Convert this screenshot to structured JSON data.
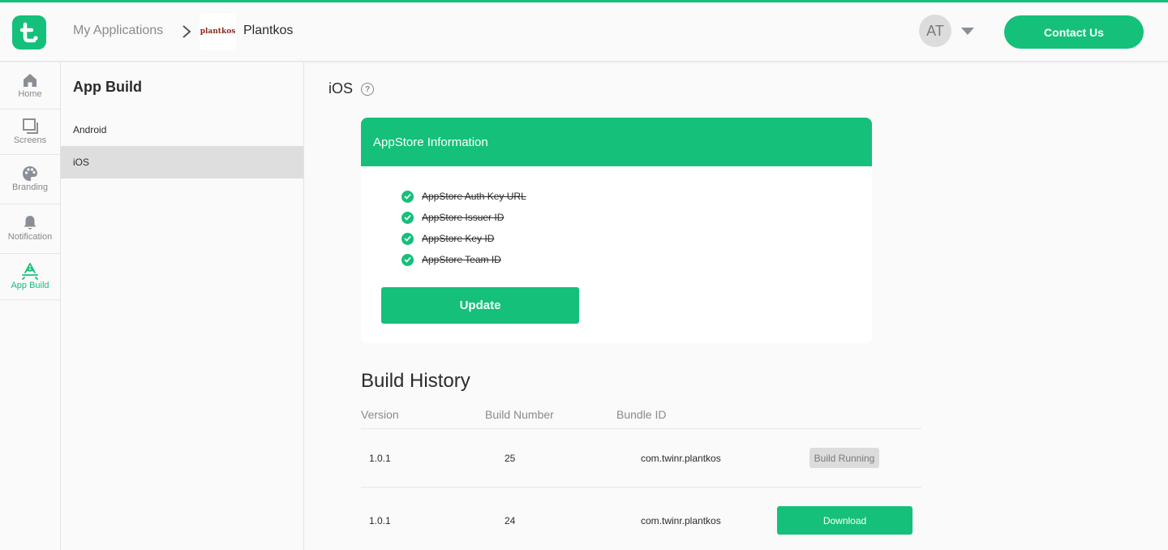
{
  "header": {
    "breadcrumb_apps": "My Applications",
    "app_logo_text": "plantkos",
    "app_name": "Plantkos",
    "avatar_initials": "AT",
    "contact_label": "Contact Us"
  },
  "leftnav": {
    "items": [
      {
        "label": "Home",
        "icon": "home-icon"
      },
      {
        "label": "Screens",
        "icon": "screens-icon"
      },
      {
        "label": "Branding",
        "icon": "palette-icon"
      },
      {
        "label": "Notification",
        "icon": "bell-icon"
      },
      {
        "label": "App Build",
        "icon": "app-build-icon",
        "active": true
      }
    ]
  },
  "subpanel": {
    "title": "App Build",
    "items": [
      {
        "label": "Android"
      },
      {
        "label": "iOS",
        "active": true
      }
    ]
  },
  "main": {
    "platform_title": "iOS",
    "help_glyph": "?",
    "card": {
      "title": "AppStore Information",
      "checks": [
        "AppStore Auth Key URL",
        "AppStore Issuer ID",
        "AppStore Key ID",
        "AppStore Team ID"
      ],
      "update_label": "Update"
    },
    "history": {
      "title": "Build History",
      "columns": [
        "Version",
        "Build Number",
        "Bundle ID"
      ],
      "rows": [
        {
          "version": "1.0.1",
          "build": "25",
          "bundle": "com.twinr.plantkos",
          "status": "Build Running"
        },
        {
          "version": "1.0.1",
          "build": "24",
          "bundle": "com.twinr.plantkos",
          "action": "Download"
        }
      ]
    }
  },
  "colors": {
    "accent": "#14c07a",
    "muted": "#8a8a8a"
  }
}
